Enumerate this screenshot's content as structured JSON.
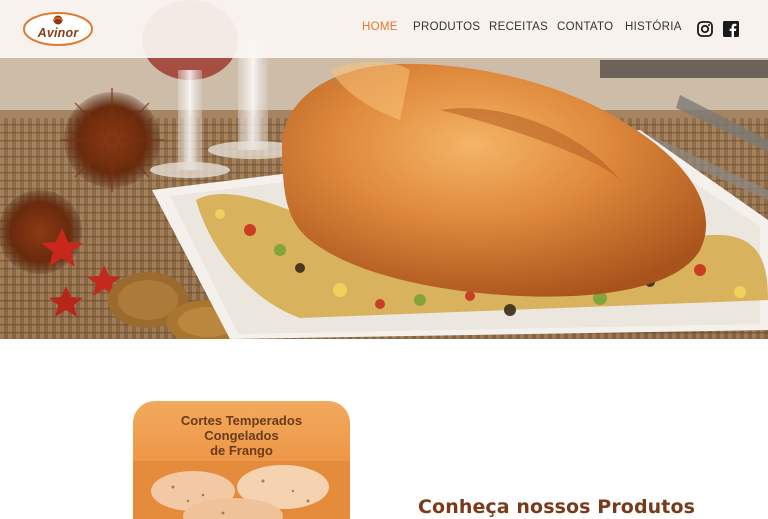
{
  "brand": {
    "logo_text": "Avinor",
    "color": "#8a3c14",
    "accent": "#e8772e"
  },
  "nav": {
    "items": [
      {
        "label": "HOME",
        "active": true
      },
      {
        "label": "PRODUTOS",
        "active": false
      },
      {
        "label": "RECEITAS",
        "active": false
      },
      {
        "label": "CONTATO",
        "active": false
      },
      {
        "label": "HISTÓRIA",
        "active": false
      }
    ]
  },
  "social": {
    "icons": [
      "instagram-icon",
      "facebook-icon"
    ]
  },
  "hero": {
    "image": "roast-chicken-on-platter"
  },
  "product": {
    "title": "Cortes Temperados\nCongelados\nde Frango"
  },
  "section": {
    "title": "Conheça nossos Produtos"
  }
}
